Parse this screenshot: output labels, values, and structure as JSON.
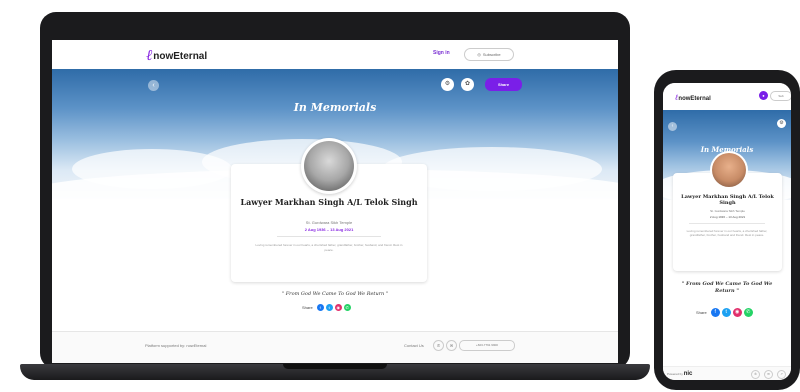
{
  "laptop": {
    "nav": {
      "logo_text": "nowEternal",
      "sign_in": "Sign in",
      "subscribe": "Subscribe"
    },
    "hero": {
      "title": "In Memorials",
      "share_button": "Share"
    },
    "profile": {
      "name": "Lawyer Markhan Singh A/L Telok Singh",
      "cemetery": "St. Gurdwara Sikh Temple",
      "dates": "2 Aug 1936 – 13 Aug 2021",
      "tribute": "Loving remembered forever in our hearts, a cherished father, grandfather, brother, husband, and friend. Rest in peace."
    },
    "quote": "\" From God We Came To God We Return \"",
    "share_label": "Share",
    "footer": {
      "powered_by": "Platform supported by: nowEternal",
      "contact_label": "Contact Us",
      "phone": "+603-7791 9900"
    }
  },
  "phone": {
    "nav": {
      "logo_text": "nowEternal",
      "subscribe": "Sub"
    },
    "hero": {
      "title": "In Memorials"
    },
    "profile": {
      "name": "Lawyer Markhan Singh A/L Telok Singh",
      "cemetery": "St. Gurdwara Sikh Temple",
      "dates": "2 Aug 1936 – 13 Aug 2021",
      "tribute": "Loving remembered forever in our hearts, a cherished father, grandfather, brother, husband and friend. Rest in peace."
    },
    "quote": "\" From God We Came To God We Return \"",
    "share_label": "Share",
    "footer": {
      "powered_by": "Powered by",
      "brand": "nic"
    }
  },
  "colors": {
    "accent": "#7a1fe8",
    "facebook": "#1877f2",
    "twitter": "#1da1f2",
    "instagram": "#e1306c",
    "whatsapp": "#25d366"
  },
  "icons": [
    "back-arrow-icon",
    "gear-icon",
    "flower-icon",
    "facebook-icon",
    "twitter-icon",
    "instagram-icon",
    "whatsapp-icon",
    "phone-icon",
    "mail-icon"
  ]
}
